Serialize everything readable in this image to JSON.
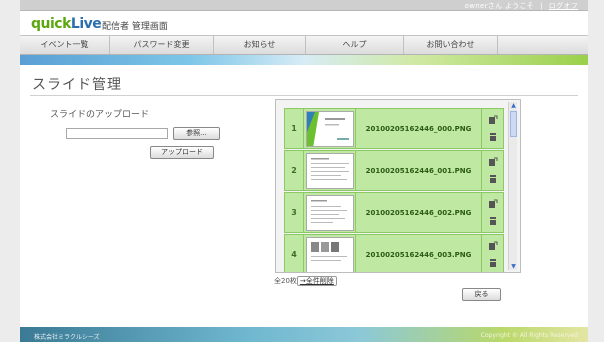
{
  "topbar": {
    "user_greeting": "ownerさん ようこそ",
    "separator": "|",
    "logout_label": "ログオフ"
  },
  "header": {
    "logo_part1": "quick",
    "logo_part2": "Live",
    "subtitle": "配信者 管理画面"
  },
  "nav": {
    "items": [
      {
        "label": "イベント一覧"
      },
      {
        "label": "パスワード変更"
      },
      {
        "label": "お知らせ"
      },
      {
        "label": "ヘルプ"
      },
      {
        "label": "お問い合わせ"
      }
    ]
  },
  "page": {
    "title": "スライド管理",
    "upload_heading": "スライドのアップロード",
    "browse_label": "参照...",
    "upload_label": "アップロード",
    "file_input_value": ""
  },
  "slides": [
    {
      "num": "1",
      "filename": "20100205162446_000.PNG"
    },
    {
      "num": "2",
      "filename": "20100205162446_001.PNG"
    },
    {
      "num": "3",
      "filename": "20100205162446_002.PNG"
    },
    {
      "num": "4",
      "filename": "20100205162446_003.PNG"
    }
  ],
  "list_footer": {
    "total": "全20枚",
    "delete_all": "→全件削除"
  },
  "back_label": "戻る",
  "footer": {
    "company": "株式会社ミラクルシーズ",
    "right_text": "Copyright © All Rights Reserved"
  },
  "colors": {
    "row_bg": "#bfe9a2",
    "logo_green": "#5aa80f",
    "logo_blue": "#2a6fb0"
  }
}
